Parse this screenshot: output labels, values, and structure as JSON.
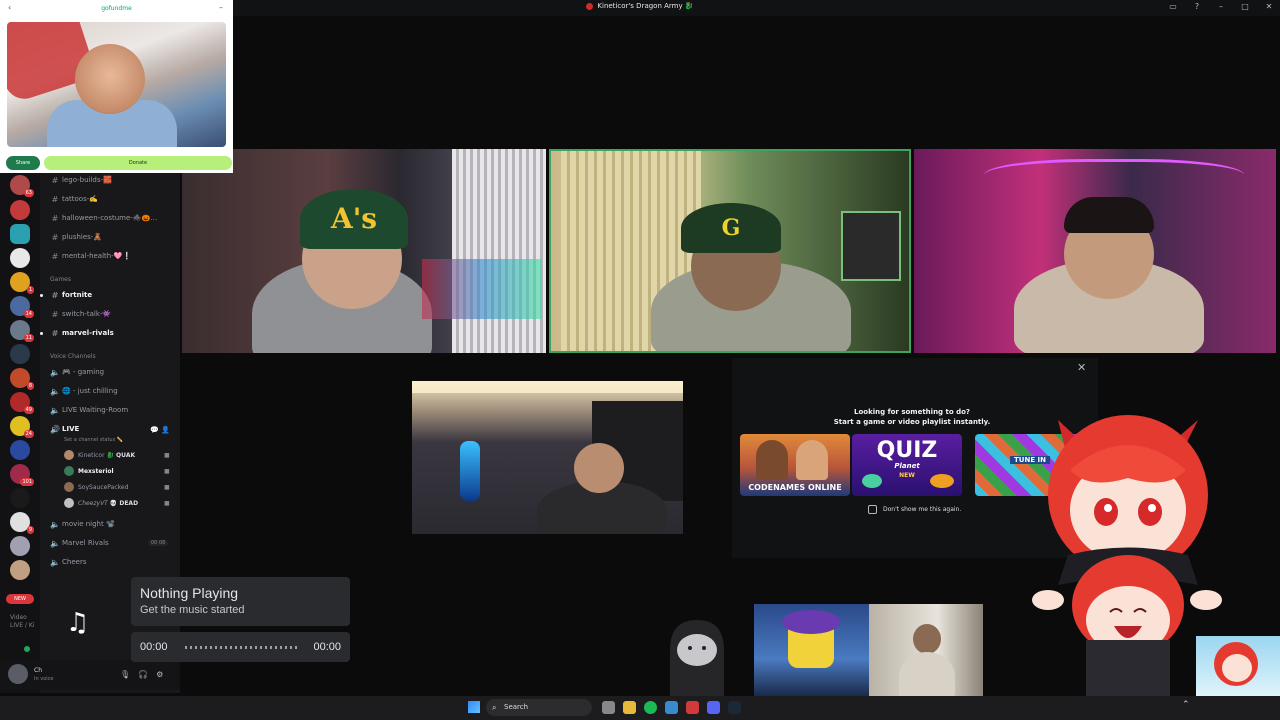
{
  "window": {
    "title": "Kineticor's Dragon Army 🐉"
  },
  "gofundme": {
    "brand": "gofundme",
    "share_label": "Share",
    "donate_label": "Donate"
  },
  "servers": [
    {
      "badge": "63"
    },
    {
      "badge": ""
    },
    {
      "badge": ""
    },
    {
      "badge": ""
    },
    {
      "badge": "1"
    },
    {
      "badge": "14"
    },
    {
      "badge": "11"
    },
    {
      "badge": ""
    },
    {
      "badge": "8"
    },
    {
      "badge": "49"
    },
    {
      "badge": "24"
    },
    {
      "badge": ""
    },
    {
      "badge": "101"
    },
    {
      "badge": ""
    },
    {
      "badge": "9"
    },
    {
      "badge": ""
    },
    {
      "badge": ""
    }
  ],
  "rail_new_label": "NEW",
  "channels": {
    "text_channels": [
      {
        "label": "lego-builds-🧱",
        "bold": false
      },
      {
        "label": "tattoos-✍️",
        "bold": false
      },
      {
        "label": "halloween-costume-🕷️🎃…",
        "bold": false
      },
      {
        "label": "plushies-🧸",
        "bold": false
      },
      {
        "label": "mental-health-🩷❕",
        "bold": false
      }
    ],
    "games_category": "Games",
    "game_channels": [
      {
        "label": "fortnite",
        "bold": true
      },
      {
        "label": "switch-talk-👾",
        "bold": false
      },
      {
        "label": "marvel-rivals",
        "bold": true
      }
    ],
    "voice_category": "Voice Channels",
    "voice_channels": [
      {
        "label": "🎮 - gaming"
      },
      {
        "label": "🌐 - just chilling"
      },
      {
        "label": "LIVE Waiting-Room"
      }
    ],
    "live_channel": {
      "label": "LIVE",
      "sub": "Set a channel status ✏️"
    },
    "live_users": [
      {
        "name": "Kineticor",
        "tag": "🐉 QUAK",
        "color": "#b08a6a"
      },
      {
        "name": "Mexsteriol",
        "tag": "",
        "color": "#3b7a57"
      },
      {
        "name": "SoySaucePacked",
        "tag": "",
        "color": "#8a6b4f"
      },
      {
        "name": "CheezyVT",
        "tag": "💀 DEAD",
        "color": "#c0c0c0"
      }
    ],
    "after_channels": [
      {
        "label": "movie night 📽️"
      },
      {
        "label": "Marvel Rivals",
        "pill": "00 08"
      },
      {
        "label": "Cheers"
      }
    ]
  },
  "voice_status": {
    "line1": "Video",
    "line2": "LIVE / Ki"
  },
  "user_panel": {
    "name": "Ch",
    "status": "In voice"
  },
  "music": {
    "title": "Nothing Playing",
    "subtitle": "Get the music started",
    "time_start": "00:00",
    "time_end": "00:00",
    "progress": 0
  },
  "popup": {
    "heading_line1": "Looking for something to do?",
    "heading_line2": "Start a game or video playlist instantly.",
    "cards": [
      {
        "label": "CODENAMES ONLINE"
      },
      {
        "label": "QUIZ",
        "sub": "Planet",
        "badge": "NEW"
      },
      {
        "label": "TUNE IN"
      }
    ],
    "checkbox_label": "Don't show me this again."
  },
  "taskbar": {
    "search_placeholder": "Search"
  },
  "colors": {
    "discord_bg": "#18181b",
    "speaking_ring": "#3ba55c",
    "accent_red": "#da373c"
  }
}
